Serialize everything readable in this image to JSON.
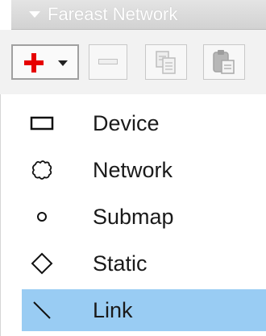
{
  "panel": {
    "title": "Fareast Network"
  },
  "toolbar": {
    "buttons": [
      {
        "name": "add",
        "icon": "plus-icon",
        "color": "#e60000",
        "has_dropdown": true
      },
      {
        "name": "remove",
        "icon": "minus-icon",
        "enabled": false
      },
      {
        "name": "copy",
        "icon": "copy-icon",
        "enabled": false
      },
      {
        "name": "paste",
        "icon": "paste-icon",
        "enabled": false
      }
    ]
  },
  "menu": {
    "items": [
      {
        "label": "Device",
        "icon": "rectangle-icon"
      },
      {
        "label": "Network",
        "icon": "cloud-icon"
      },
      {
        "label": "Submap",
        "icon": "circle-icon"
      },
      {
        "label": "Static",
        "icon": "diamond-icon"
      },
      {
        "label": "Link",
        "icon": "diagonal-line-icon",
        "highlighted": true
      }
    ],
    "highlight_color": "#99ccf3"
  }
}
